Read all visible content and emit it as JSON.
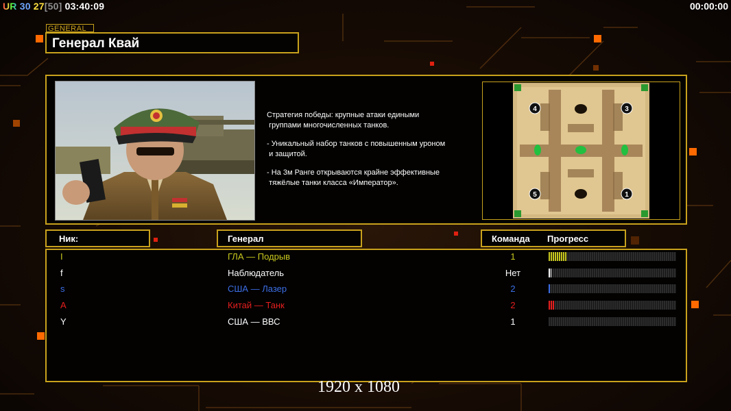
{
  "hud": {
    "faction_code": "UR",
    "ping": "30",
    "fps": "27",
    "fps_cap": "[50]",
    "clock": "03:40:09",
    "timer": "00:00:00"
  },
  "general_tag": "GENERAL",
  "general_title": "Генерал Квай",
  "strategy": [
    "Стратегия победы: крупные атаки едиными\n группами многочисленных танков.",
    "- Уникальный набор танков с повышенным уроном\n и защитой.",
    "- На 3м Ранге открываются крайне эффективные\n тяжёлые танки класса «Император»."
  ],
  "map": {
    "slots": [
      "4",
      "3",
      "5",
      "1"
    ]
  },
  "columns": {
    "nick": "Ник:",
    "general": "Генерал",
    "team": "Команда",
    "progress": "Прогресс"
  },
  "players": [
    {
      "nick": "I",
      "general": "ГЛА — Подрыв",
      "team": "1",
      "color": "#c8c81e",
      "progress": 0.14
    },
    {
      "nick": "f",
      "general": "Наблюдатель",
      "team": "Нет",
      "color": "#ffffff",
      "progress": 0.02
    },
    {
      "nick": "s",
      "general": "США — Лазер",
      "team": "2",
      "color": "#3c6ee6",
      "progress": 0.01
    },
    {
      "nick": "A",
      "general": "Китай — Танк",
      "team": "2",
      "color": "#e61e1e",
      "progress": 0.05
    },
    {
      "nick": "Y",
      "general": "США — ВВС",
      "team": "1",
      "color": "#ffffff",
      "progress": 0.0
    }
  ],
  "watermark": "1920 x 1080",
  "colors": {
    "frame": "#c9a21c",
    "accent_orange": "#ff6a00"
  }
}
